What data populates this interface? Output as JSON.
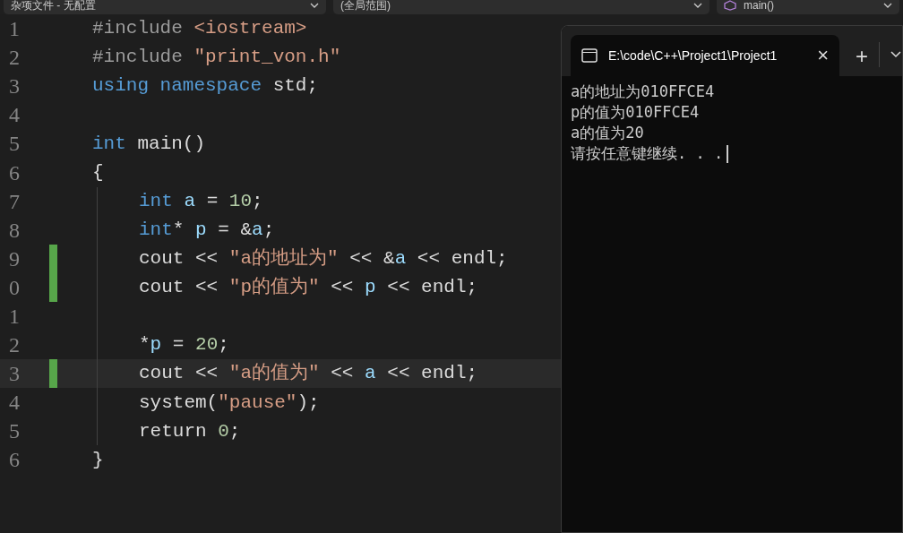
{
  "toolbar": {
    "dropdowns": [
      {
        "label": "杂项文件 - 无配置",
        "icon": false
      },
      {
        "label": "(全局范围)",
        "icon": false
      },
      {
        "label": "main()",
        "icon": true
      }
    ]
  },
  "editor": {
    "lines": [
      {
        "number": "1",
        "changed": false,
        "current": false,
        "guide": false,
        "tokens": [
          {
            "kind": "pp",
            "text": "#include "
          },
          {
            "kind": "str",
            "text": "<iostream>"
          }
        ]
      },
      {
        "number": "2",
        "changed": false,
        "current": false,
        "guide": false,
        "tokens": [
          {
            "kind": "pp",
            "text": "#include "
          },
          {
            "kind": "str",
            "text": "\"print_von.h\""
          }
        ]
      },
      {
        "number": "3",
        "changed": false,
        "current": false,
        "guide": false,
        "tokens": [
          {
            "kind": "kw",
            "text": "using namespace "
          },
          {
            "kind": "plain",
            "text": "std;"
          }
        ]
      },
      {
        "number": "4",
        "changed": false,
        "current": false,
        "guide": false
      },
      {
        "number": "5",
        "changed": false,
        "current": false,
        "guide": false,
        "tokens": [
          {
            "kind": "kw",
            "text": "int "
          },
          {
            "kind": "plain",
            "text": "main()"
          }
        ]
      },
      {
        "number": "6",
        "changed": false,
        "current": false,
        "guide": false,
        "tokens": [
          {
            "kind": "plain",
            "text": "{"
          }
        ]
      },
      {
        "number": "7",
        "changed": false,
        "current": false,
        "guide": true,
        "tokens": [
          {
            "kind": "kw",
            "text": "int "
          },
          {
            "kind": "var",
            "text": "a"
          },
          {
            "kind": "plain",
            "text": " = "
          },
          {
            "kind": "num",
            "text": "10"
          },
          {
            "kind": "plain",
            "text": ";"
          }
        ]
      },
      {
        "number": "8",
        "changed": false,
        "current": false,
        "guide": true,
        "tokens": [
          {
            "kind": "kw",
            "text": "int"
          },
          {
            "kind": "plain",
            "text": "* "
          },
          {
            "kind": "var",
            "text": "p"
          },
          {
            "kind": "plain",
            "text": " = &"
          },
          {
            "kind": "var",
            "text": "a"
          },
          {
            "kind": "plain",
            "text": ";"
          }
        ]
      },
      {
        "number": "9",
        "changed": true,
        "current": false,
        "guide": true,
        "tokens": [
          {
            "kind": "plain",
            "text": "cout << "
          },
          {
            "kind": "str",
            "text": "\"a的地址为\""
          },
          {
            "kind": "plain",
            "text": " << &"
          },
          {
            "kind": "var",
            "text": "a"
          },
          {
            "kind": "plain",
            "text": " << endl;"
          }
        ]
      },
      {
        "number": "0",
        "changed": true,
        "current": false,
        "guide": true,
        "tokens": [
          {
            "kind": "plain",
            "text": "cout << "
          },
          {
            "kind": "str",
            "text": "\"p的值为\""
          },
          {
            "kind": "plain",
            "text": " << "
          },
          {
            "kind": "var",
            "text": "p"
          },
          {
            "kind": "plain",
            "text": " << endl;"
          }
        ]
      },
      {
        "number": "1",
        "changed": false,
        "current": false,
        "guide": true
      },
      {
        "number": "2",
        "changed": false,
        "current": false,
        "guide": true,
        "tokens": [
          {
            "kind": "plain",
            "text": "*"
          },
          {
            "kind": "var",
            "text": "p"
          },
          {
            "kind": "plain",
            "text": " = "
          },
          {
            "kind": "num",
            "text": "20"
          },
          {
            "kind": "plain",
            "text": ";"
          }
        ]
      },
      {
        "number": "3",
        "changed": true,
        "current": true,
        "guide": true,
        "tokens": [
          {
            "kind": "plain",
            "text": "cout << "
          },
          {
            "kind": "str",
            "text": "\"a的值为\""
          },
          {
            "kind": "plain",
            "text": " << "
          },
          {
            "kind": "var",
            "text": "a"
          },
          {
            "kind": "plain",
            "text": " << endl;"
          }
        ]
      },
      {
        "number": "4",
        "changed": false,
        "current": false,
        "guide": true,
        "tokens": [
          {
            "kind": "plain",
            "text": "system("
          },
          {
            "kind": "str",
            "text": "\"pause\""
          },
          {
            "kind": "plain",
            "text": ");"
          }
        ]
      },
      {
        "number": "5",
        "changed": false,
        "current": false,
        "guide": true,
        "tokens": [
          {
            "kind": "plain",
            "text": "return "
          },
          {
            "kind": "num",
            "text": "0"
          },
          {
            "kind": "plain",
            "text": ";"
          }
        ]
      },
      {
        "number": "6",
        "changed": false,
        "current": false,
        "guide": false,
        "tokens": [
          {
            "kind": "plain",
            "text": "}"
          }
        ]
      }
    ]
  },
  "terminal": {
    "tab": {
      "title": "E:\\code\\C++\\Project1\\Project1",
      "close": "×"
    },
    "new_tab": "+",
    "output": [
      "a的地址为010FFCE4",
      "p的值为010FFCE4",
      "a的值为20",
      "请按任意键继续. . ."
    ]
  }
}
